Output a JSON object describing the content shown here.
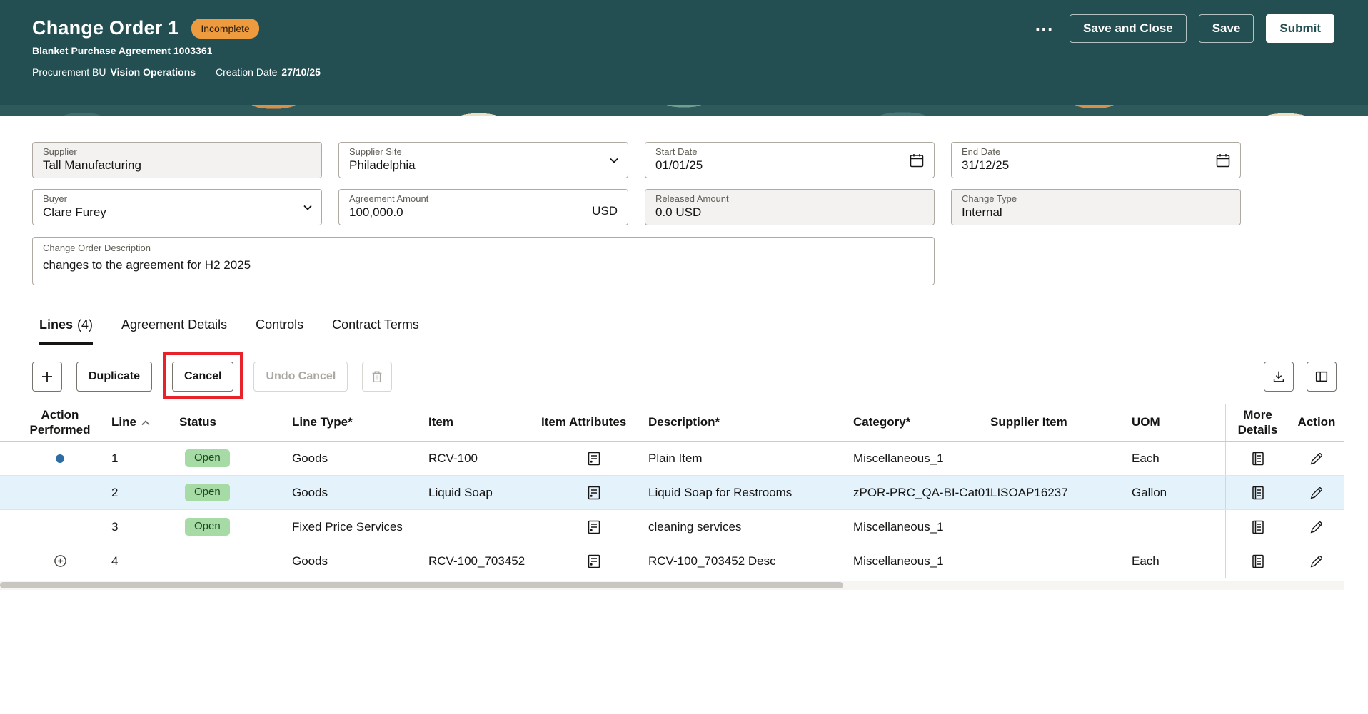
{
  "colors": {
    "header_background": "#234E52",
    "badge_incomplete_bg": "#EE9B40",
    "status_open_bg": "#A6DBA5",
    "status_open_text": "#1C4620",
    "selected_row_bg": "#E3F2FB",
    "annotation_red": "#E8222A",
    "action_dot_blue": "#2E6DA4"
  },
  "icons": {
    "more_actions": "ellipsis",
    "dropdown": "chevron-down",
    "calendar": "calendar",
    "add": "plus",
    "delete": "trash",
    "export": "download-tray",
    "manage_columns": "split-columns",
    "sort_ascending": "chevron-up",
    "item_attributes": "document-list",
    "more_details": "document-lines",
    "edit": "pencil",
    "action_changed": "blue-dot",
    "action_added": "circle-plus"
  },
  "header": {
    "title": "Change Order 1",
    "status_badge": "Incomplete",
    "subtitle": "Blanket Purchase Agreement 1003361",
    "meta": {
      "procurement_bu_label": "Procurement BU",
      "procurement_bu_value": "Vision Operations",
      "creation_date_label": "Creation Date",
      "creation_date_value": "27/10/25"
    },
    "actions": {
      "more": "⋯",
      "save_and_close": "Save and Close",
      "save": "Save",
      "submit": "Submit"
    }
  },
  "form": {
    "supplier": {
      "label": "Supplier",
      "value": "Tall Manufacturing"
    },
    "supplier_site": {
      "label": "Supplier Site",
      "value": "Philadelphia"
    },
    "start_date": {
      "label": "Start Date",
      "value": "01/01/25"
    },
    "end_date": {
      "label": "End Date",
      "value": "31/12/25"
    },
    "buyer": {
      "label": "Buyer",
      "value": "Clare Furey"
    },
    "agreement_amount": {
      "label": "Agreement Amount",
      "value": "100,000.0",
      "currency": "USD"
    },
    "released_amount": {
      "label": "Released Amount",
      "value": "0.0 USD"
    },
    "change_type": {
      "label": "Change Type",
      "value": "Internal"
    },
    "description": {
      "label": "Change Order Description",
      "value": "changes to the agreement for H2 2025"
    }
  },
  "tabs": [
    {
      "label": "Lines",
      "count": "(4)"
    },
    {
      "label": "Agreement Details"
    },
    {
      "label": "Controls"
    },
    {
      "label": "Contract Terms"
    }
  ],
  "toolbar": {
    "duplicate": "Duplicate",
    "cancel": "Cancel",
    "undo_cancel": "Undo Cancel"
  },
  "table": {
    "columns": {
      "action_performed": "Action Performed",
      "line": "Line",
      "status": "Status",
      "line_type": "Line Type*",
      "item": "Item",
      "item_attributes": "Item Attributes",
      "description": "Description*",
      "category": "Category*",
      "supplier_item": "Supplier Item",
      "uom": "UOM",
      "more_details": "More Details",
      "action": "Action"
    },
    "rows": [
      {
        "line": "1",
        "status": "Open",
        "line_type": "Goods",
        "item": "RCV-100",
        "description": "Plain Item",
        "category": "Miscellaneous_1",
        "supplier_item": "",
        "uom": "Each"
      },
      {
        "line": "2",
        "status": "Open",
        "line_type": "Goods",
        "item": "Liquid Soap",
        "description": "Liquid Soap for Restrooms",
        "category": "zPOR-PRC_QA-BI-Cat01",
        "supplier_item": "LISOAP16237",
        "uom": "Gallon"
      },
      {
        "line": "3",
        "status": "Open",
        "line_type": "Fixed Price Services",
        "item": "",
        "description": "cleaning services",
        "category": "Miscellaneous_1",
        "supplier_item": "",
        "uom": ""
      },
      {
        "line": "4",
        "status": "",
        "line_type": "Goods",
        "item": "RCV-100_703452",
        "description": "RCV-100_703452 Desc",
        "category": "Miscellaneous_1",
        "supplier_item": "",
        "uom": "Each"
      }
    ]
  }
}
